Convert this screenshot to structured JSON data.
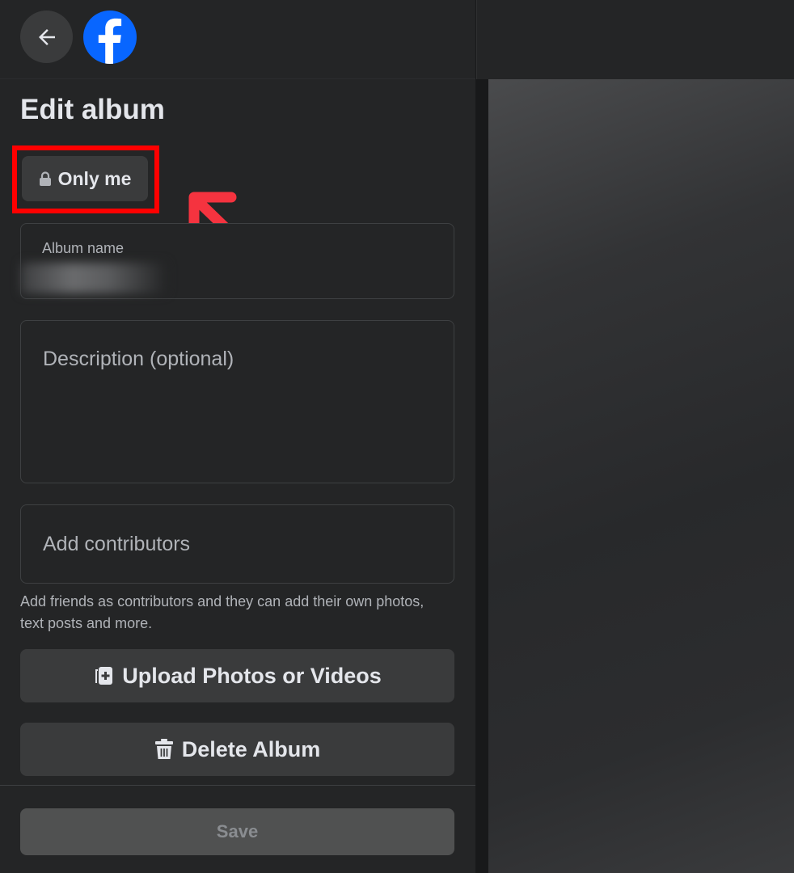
{
  "header": {
    "back_icon": "arrow-left-icon",
    "logo_icon": "facebook-logo-icon"
  },
  "title": "Edit album",
  "privacy": {
    "label": "Only me",
    "icon": "lock-icon"
  },
  "album_name": {
    "label": "Album name"
  },
  "description": {
    "placeholder": "Description (optional)"
  },
  "contributors": {
    "placeholder": "Add contributors",
    "helper": "Add friends as contributors and they can add their own photos, text posts and more."
  },
  "actions": {
    "upload_label": "Upload Photos or Videos",
    "upload_icon": "photo-add-icon",
    "delete_label": "Delete Album",
    "delete_icon": "trash-icon",
    "save_label": "Save"
  },
  "colors": {
    "highlight": "#ff0000",
    "brand": "#0866ff"
  }
}
